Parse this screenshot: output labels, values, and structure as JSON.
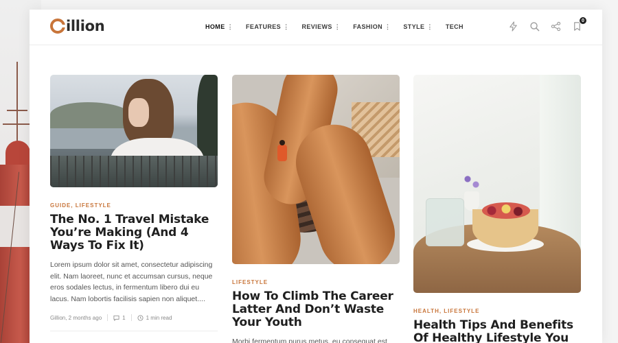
{
  "brand": {
    "name": "illion",
    "logo_letter": "G",
    "accent": "#c8753a"
  },
  "nav": {
    "items": [
      {
        "label": "HOME",
        "has_menu": true,
        "active": true
      },
      {
        "label": "FEATURES",
        "has_menu": true
      },
      {
        "label": "REVIEWS",
        "has_menu": true
      },
      {
        "label": "FASHION",
        "has_menu": true
      },
      {
        "label": "STYLE",
        "has_menu": true
      },
      {
        "label": "TECH",
        "has_menu": false
      }
    ],
    "menu_glyph": "⋮"
  },
  "header_icons": {
    "flash": "bolt-icon",
    "search": "search-icon",
    "share": "share-icon",
    "bookmark": "bookmark-icon",
    "bookmark_count": "0"
  },
  "posts": [
    {
      "categories": "GUIDE, LIFESTYLE",
      "title": "The No. 1 Travel Mistake You’re Making (And 4 Ways To Fix It)",
      "excerpt": "Lorem ipsum dolor sit amet, consectetur adipiscing elit. Nam laoreet, nunc et accumsan cursus, neque eros sodales lectus, in fermentum libero dui eu lacus. Nam lobortis facilisis sapien non aliquet....",
      "author_date": "Gillion, 2 months ago",
      "comments": "1",
      "read_time": "1 min read"
    },
    {
      "categories": "LIFESTYLE",
      "title": "How To Climb The Career Latter And Don’t Waste Your Youth",
      "excerpt": "Morbi fermentum purus metus, eu consequat est"
    },
    {
      "categories": "HEALTH, LIFESTYLE",
      "title": "Health Tips And Benefits Of Healthy Lifestyle You"
    }
  ]
}
